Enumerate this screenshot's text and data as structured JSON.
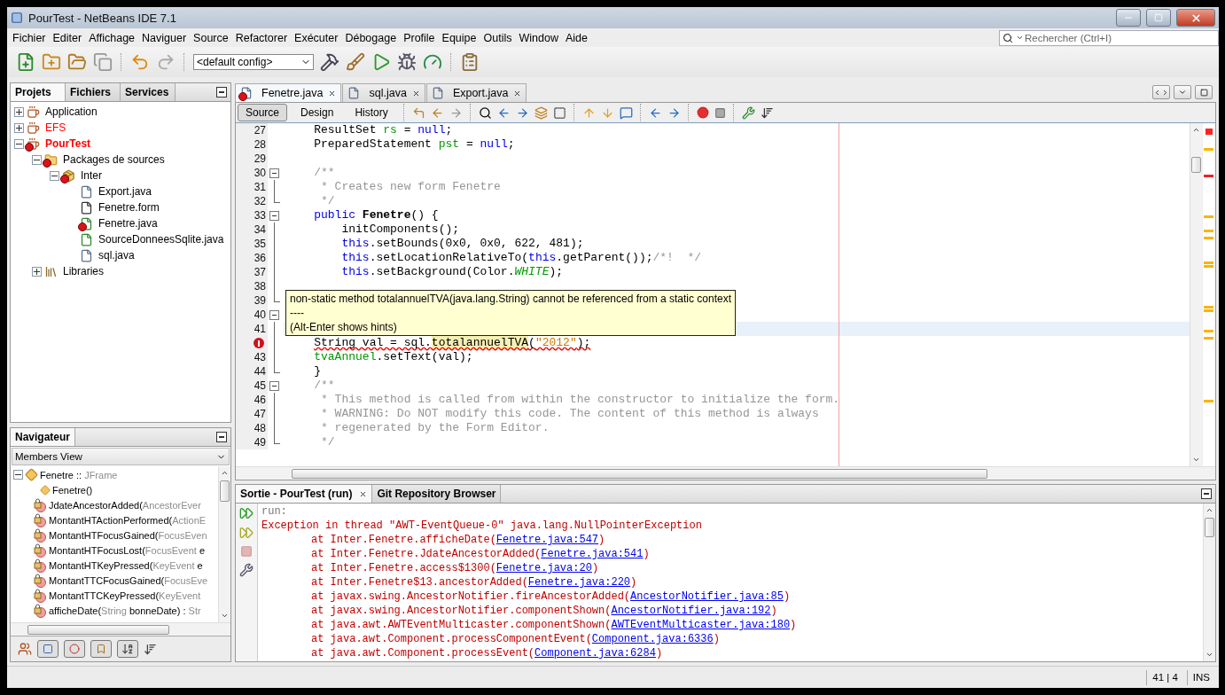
{
  "window": {
    "title": "PourTest - NetBeans IDE 7.1"
  },
  "menu": [
    "Fichier",
    "Editer",
    "Affichage",
    "Naviguer",
    "Source",
    "Refactorer",
    "Exécuter",
    "Débogage",
    "Profile",
    "Equipe",
    "Outils",
    "Window",
    "Aide"
  ],
  "search": {
    "placeholder": "Rechercher (Ctrl+I)"
  },
  "toolbar": {
    "config": "<default config>"
  },
  "project_panel": {
    "tabs": [
      {
        "label": "Projets",
        "selected": true
      },
      {
        "label": "Fichiers",
        "selected": false
      },
      {
        "label": "Services",
        "selected": false
      }
    ],
    "tree": [
      {
        "label": "Application",
        "kind": "project",
        "expanded": false,
        "broken": false,
        "main": false,
        "error": false
      },
      {
        "label": "EFS",
        "kind": "project",
        "expanded": false,
        "broken": true,
        "main": false,
        "error": false
      },
      {
        "label": "PourTest",
        "kind": "project",
        "expanded": true,
        "broken": true,
        "main": true,
        "error": true,
        "children": [
          {
            "label": "Packages de sources",
            "kind": "sources",
            "expanded": true,
            "error": true,
            "children": [
              {
                "label": "Inter",
                "kind": "package",
                "expanded": true,
                "error": true,
                "children": [
                  {
                    "label": "Export.java",
                    "kind": "java",
                    "error": false
                  },
                  {
                    "label": "Fenetre.form",
                    "kind": "form",
                    "error": false
                  },
                  {
                    "label": "Fenetre.java",
                    "kind": "java-main",
                    "error": true
                  },
                  {
                    "label": "SourceDonneesSqlite.java",
                    "kind": "java-main",
                    "error": false
                  },
                  {
                    "label": "sql.java",
                    "kind": "java",
                    "error": false
                  }
                ]
              }
            ]
          },
          {
            "label": "Libraries",
            "kind": "libraries",
            "expanded": false,
            "error": false
          }
        ]
      }
    ]
  },
  "navigator": {
    "tab": "Navigateur",
    "view": "Members View",
    "root": {
      "parts": [
        {
          "text": "Fenetre :: ",
          "muted": false
        },
        {
          "text": "JFrame",
          "muted": true
        }
      ]
    },
    "members": [
      {
        "kind": "constructor",
        "parts": [
          {
            "text": "Fenetre()",
            "muted": false
          }
        ]
      },
      {
        "kind": "private-method",
        "parts": [
          {
            "text": "JdateAncestorAdded(",
            "muted": false
          },
          {
            "text": "AncestorEver",
            "muted": true
          }
        ]
      },
      {
        "kind": "private-method",
        "parts": [
          {
            "text": "MontantHTActionPerformed(",
            "muted": false
          },
          {
            "text": "ActionE",
            "muted": true
          }
        ]
      },
      {
        "kind": "private-method",
        "parts": [
          {
            "text": "MontantHTFocusGained(",
            "muted": false
          },
          {
            "text": "FocusEven",
            "muted": true
          }
        ]
      },
      {
        "kind": "private-method",
        "parts": [
          {
            "text": "MontantHTFocusLost(",
            "muted": false
          },
          {
            "text": "FocusEvent",
            "muted": true
          },
          {
            "text": " e",
            "muted": false
          }
        ]
      },
      {
        "kind": "private-method",
        "parts": [
          {
            "text": "MontantHTKeyPressed(",
            "muted": false
          },
          {
            "text": "KeyEvent",
            "muted": true
          },
          {
            "text": " e",
            "muted": false
          }
        ]
      },
      {
        "kind": "private-method",
        "parts": [
          {
            "text": "MontantTTCFocusGained(",
            "muted": false
          },
          {
            "text": "FocusEve",
            "muted": true
          }
        ]
      },
      {
        "kind": "private-method",
        "parts": [
          {
            "text": "MontantTTCKeyPressed(",
            "muted": false
          },
          {
            "text": "KeyEvent",
            "muted": true
          }
        ]
      },
      {
        "kind": "private-method",
        "parts": [
          {
            "text": "afficheDate(",
            "muted": false
          },
          {
            "text": "String",
            "muted": true
          },
          {
            "text": " bonneDate) : ",
            "muted": false
          },
          {
            "text": "Str",
            "muted": true
          }
        ]
      }
    ]
  },
  "editor": {
    "tabs": [
      {
        "label": "Fenetre.java",
        "selected": true,
        "error": true
      },
      {
        "label": "sql.java",
        "selected": false,
        "error": false
      },
      {
        "label": "Export.java",
        "selected": false,
        "error": false
      }
    ],
    "views": [
      {
        "label": "Source",
        "selected": true
      },
      {
        "label": "Design",
        "selected": false
      },
      {
        "label": "History",
        "selected": false
      }
    ],
    "lines": [
      {
        "number": "27",
        "kind": "plain",
        "error": false,
        "current": false,
        "tokens": [
          {
            "text": "    ResultSet ",
            "kind": "plain"
          },
          {
            "text": "rs",
            "kind": "field"
          },
          {
            "text": " = ",
            "kind": "plain"
          },
          {
            "text": "null",
            "kind": "keyword"
          },
          {
            "text": ";",
            "kind": "plain"
          }
        ]
      },
      {
        "number": "28",
        "kind": "plain",
        "error": false,
        "current": false,
        "tokens": [
          {
            "text": "    PreparedStatement ",
            "kind": "plain"
          },
          {
            "text": "pst",
            "kind": "field"
          },
          {
            "text": " = ",
            "kind": "plain"
          },
          {
            "text": "null",
            "kind": "keyword"
          },
          {
            "text": ";",
            "kind": "plain"
          }
        ]
      },
      {
        "number": "29",
        "kind": "plain",
        "error": false,
        "current": false
      },
      {
        "number": "30",
        "kind": "fold-start",
        "error": false,
        "current": false,
        "tokens": [
          {
            "text": "    /**",
            "kind": "comment"
          }
        ]
      },
      {
        "number": "31",
        "kind": "fold-body",
        "error": false,
        "current": false,
        "tokens": [
          {
            "text": "     * Creates new form Fenetre",
            "kind": "comment"
          }
        ]
      },
      {
        "number": "32",
        "kind": "fold-end",
        "error": false,
        "current": false,
        "tokens": [
          {
            "text": "     */",
            "kind": "comment"
          }
        ]
      },
      {
        "number": "33",
        "kind": "fold-start",
        "error": false,
        "current": false,
        "tokens": [
          {
            "text": "    public ",
            "kind": "keyword"
          },
          {
            "text": "Fenetre",
            "kind": "declaration"
          },
          {
            "text": "() {",
            "kind": "plain"
          }
        ]
      },
      {
        "number": "34",
        "kind": "fold-body",
        "error": false,
        "current": false,
        "tokens": [
          {
            "text": "        initComponents();",
            "kind": "plain"
          }
        ]
      },
      {
        "number": "35",
        "kind": "fold-body",
        "error": false,
        "current": false,
        "tokens": [
          {
            "text": "        this",
            "kind": "keyword"
          },
          {
            "text": ".setBounds(0x0, 0x0, 622, 481);",
            "kind": "plain"
          }
        ]
      },
      {
        "number": "36",
        "kind": "fold-body",
        "error": false,
        "current": false,
        "tokens": [
          {
            "text": "        this",
            "kind": "keyword"
          },
          {
            "text": ".setLocationRelativeTo(",
            "kind": "plain"
          },
          {
            "text": "this",
            "kind": "keyword"
          },
          {
            "text": ".getParent());",
            "kind": "plain"
          },
          {
            "text": "/*!  */",
            "kind": "comment"
          }
        ]
      },
      {
        "number": "37",
        "kind": "fold-body",
        "error": false,
        "current": false,
        "tokens": [
          {
            "text": "        this",
            "kind": "keyword"
          },
          {
            "text": ".setBackground(Color.",
            "kind": "plain"
          },
          {
            "text": "WHITE",
            "kind": "constant"
          },
          {
            "text": ");",
            "kind": "plain"
          }
        ]
      },
      {
        "number": "38",
        "kind": "fold-body",
        "error": false,
        "current": false
      },
      {
        "number": "39",
        "kind": "fold-end",
        "error": false,
        "current": false
      },
      {
        "number": "40",
        "kind": "fold-start",
        "error": false,
        "current": false
      },
      {
        "number": "41",
        "kind": "fold-body",
        "error": false,
        "current": true
      },
      {
        "kind": "fold-body",
        "error": true,
        "current": false,
        "tokens": [
          {
            "text": "    String val = sql.",
            "kind": "plain"
          },
          {
            "text": "totalannuelTVA",
            "kind": "mark"
          },
          {
            "text": "(",
            "kind": "plain"
          },
          {
            "text": "\"2012\"",
            "kind": "string"
          },
          {
            "text": ");",
            "kind": "plain"
          }
        ]
      },
      {
        "number": "43",
        "kind": "fold-body",
        "error": false,
        "current": false,
        "tokens": [
          {
            "text": "    tvaAnnuel",
            "kind": "field"
          },
          {
            "text": ".setText(val);",
            "kind": "plain"
          }
        ]
      },
      {
        "number": "44",
        "kind": "fold-end",
        "error": false,
        "current": false,
        "tokens": [
          {
            "text": "    }",
            "kind": "plain"
          }
        ]
      },
      {
        "number": "45",
        "kind": "fold-start",
        "error": false,
        "current": false,
        "tokens": [
          {
            "text": "    /**",
            "kind": "comment"
          }
        ]
      },
      {
        "number": "46",
        "kind": "fold-body",
        "error": false,
        "current": false,
        "tokens": [
          {
            "text": "     * This method is called from within the constructor to initialize the form.",
            "kind": "comment"
          }
        ]
      },
      {
        "number": "47",
        "kind": "fold-body",
        "error": false,
        "current": false,
        "tokens": [
          {
            "text": "     * WARNING: Do NOT modify this code. The content of this method is always",
            "kind": "comment"
          }
        ]
      },
      {
        "number": "48",
        "kind": "fold-body",
        "error": false,
        "current": false,
        "tokens": [
          {
            "text": "     * regenerated by the Form Editor.",
            "kind": "comment"
          }
        ]
      },
      {
        "number": "49",
        "kind": "fold-end",
        "error": false,
        "current": false,
        "tokens": [
          {
            "text": "     */",
            "kind": "comment"
          }
        ]
      }
    ],
    "tooltip": {
      "lines": [
        "non-static method totalannuelTVA(java.lang.String) cannot be referenced from a static context",
        "----",
        "(Alt-Enter shows hints)"
      ]
    }
  },
  "output": {
    "tabs": [
      {
        "label": "Sortie - PourTest (run)",
        "selected": true
      },
      {
        "label": "Git Repository Browser",
        "selected": false
      }
    ],
    "lines": [
      {
        "kind": "info",
        "text": "run:"
      },
      {
        "kind": "error",
        "text": "Exception in thread \"AWT-EventQueue-0\" java.lang.NullPointerException"
      },
      {
        "kind": "trace",
        "text": "at Inter.Fenetre.afficheDate(",
        "link": "Fenetre.java:547",
        "tail": ")"
      },
      {
        "kind": "trace",
        "text": "at Inter.Fenetre.JdateAncestorAdded(",
        "link": "Fenetre.java:541",
        "tail": ")"
      },
      {
        "kind": "trace",
        "text": "at Inter.Fenetre.access$1300(",
        "link": "Fenetre.java:20",
        "tail": ")"
      },
      {
        "kind": "trace",
        "text": "at Inter.Fenetre$13.ancestorAdded(",
        "link": "Fenetre.java:220",
        "tail": ")"
      },
      {
        "kind": "trace",
        "text": "at javax.swing.AncestorNotifier.fireAncestorAdded(",
        "link": "AncestorNotifier.java:85",
        "tail": ")"
      },
      {
        "kind": "trace",
        "text": "at javax.swing.AncestorNotifier.componentShown(",
        "link": "AncestorNotifier.java:192",
        "tail": ")"
      },
      {
        "kind": "trace",
        "text": "at java.awt.AWTEventMulticaster.componentShown(",
        "link": "AWTEventMulticaster.java:180",
        "tail": ")"
      },
      {
        "kind": "trace",
        "text": "at java.awt.Component.processComponentEvent(",
        "link": "Component.java:6336",
        "tail": ")"
      },
      {
        "kind": "trace",
        "text": "at java.awt.Component.processEvent(",
        "link": "Component.java:6284",
        "tail": ")"
      }
    ]
  },
  "status_bar": {
    "position": "41 | 4",
    "mode": "INS"
  }
}
